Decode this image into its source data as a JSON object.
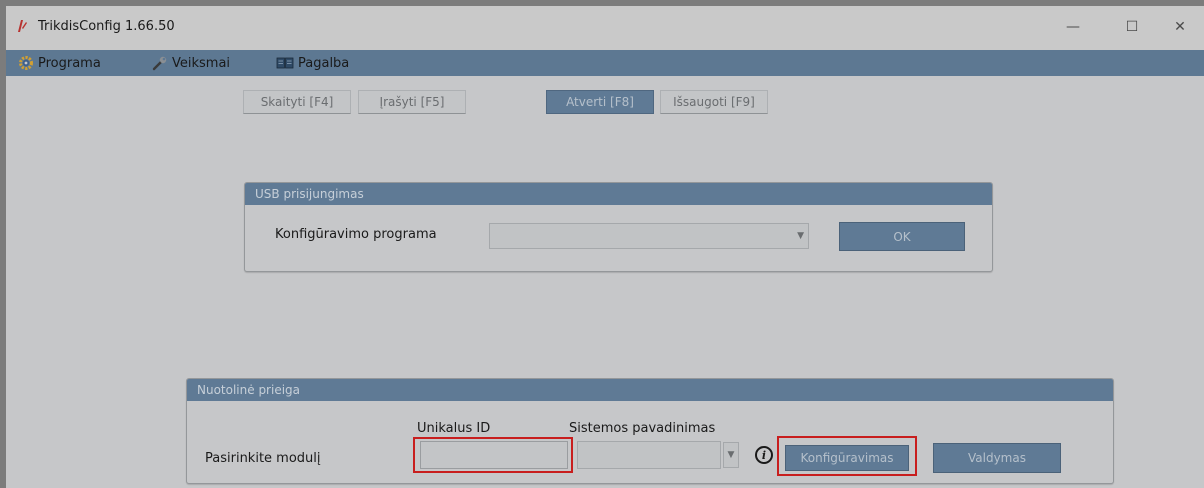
{
  "window": {
    "title": "TrikdisConfig 1.66.50",
    "controls": {
      "minimize": "—",
      "maximize": "☐",
      "close": "✕"
    }
  },
  "menubar": {
    "items": [
      {
        "label": "Programa",
        "icon": "gear-icon"
      },
      {
        "label": "Veiksmai",
        "icon": "wrench-icon"
      },
      {
        "label": "Pagalba",
        "icon": "book-icon"
      }
    ]
  },
  "toolbar": {
    "read": "Skaityti [F4]",
    "write": "Įrašyti [F5]",
    "open": "Atverti [F8]",
    "save": "Išsaugoti [F9]"
  },
  "usb_panel": {
    "header": "USB prisijungimas",
    "program_label": "Konfigūravimo programa",
    "program_value": "",
    "ok": "OK"
  },
  "remote_panel": {
    "header": "Nuotolinė prieiga",
    "unique_id_label": "Unikalus ID",
    "unique_id_value": "",
    "system_name_label": "Sistemos pavadinimas",
    "system_name_value": "",
    "select_module_label": "Pasirinkite modulį",
    "configure": "Konfigūravimas",
    "control": "Valdymas"
  },
  "colors": {
    "accent": "#5f7a95",
    "highlight": "#c81e1e",
    "window_bg": "#c6c7c9"
  }
}
